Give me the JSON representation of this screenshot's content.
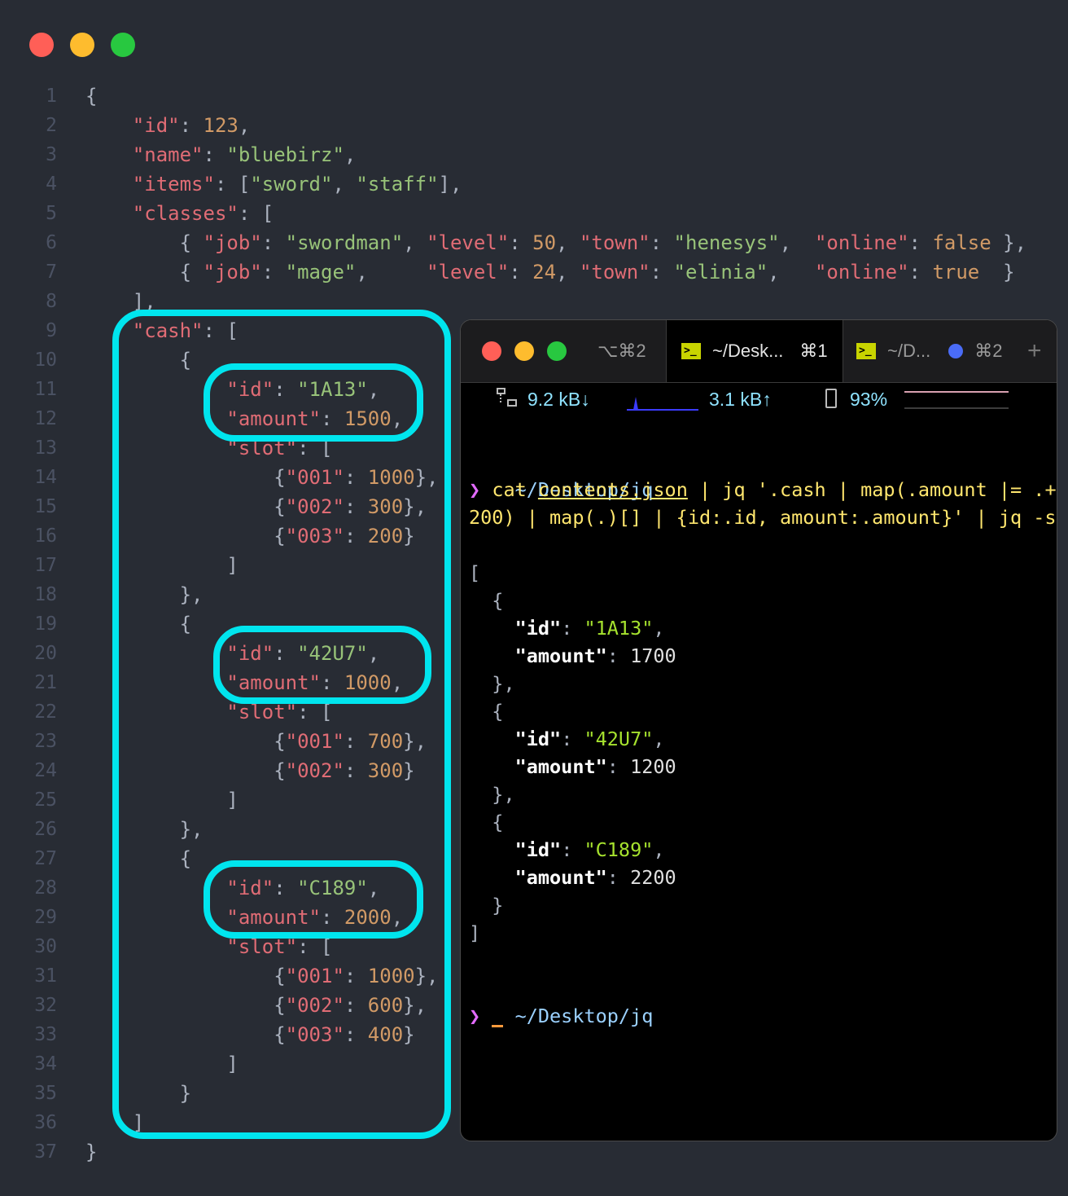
{
  "editor": {
    "line_numbers": [
      "1",
      "2",
      "3",
      "4",
      "5",
      "6",
      "7",
      "8",
      "9",
      "10",
      "11",
      "12",
      "13",
      "14",
      "15",
      "16",
      "17",
      "18",
      "19",
      "20",
      "21",
      "22",
      "23",
      "24",
      "25",
      "26",
      "27",
      "28",
      "29",
      "30",
      "31",
      "32",
      "33",
      "34",
      "35",
      "36",
      "37"
    ],
    "lines": [
      [
        [
          "p",
          "{"
        ]
      ],
      [
        [
          "p",
          "    "
        ],
        [
          "k",
          "\"id\""
        ],
        [
          "p",
          ": "
        ],
        [
          "n",
          "123"
        ],
        [
          "p",
          ","
        ]
      ],
      [
        [
          "p",
          "    "
        ],
        [
          "k",
          "\"name\""
        ],
        [
          "p",
          ": "
        ],
        [
          "s",
          "\"bluebirz\""
        ],
        [
          "p",
          ","
        ]
      ],
      [
        [
          "p",
          "    "
        ],
        [
          "k",
          "\"items\""
        ],
        [
          "p",
          ": ["
        ],
        [
          "s",
          "\"sword\""
        ],
        [
          "p",
          ", "
        ],
        [
          "s",
          "\"staff\""
        ],
        [
          "p",
          "],"
        ]
      ],
      [
        [
          "p",
          "    "
        ],
        [
          "k",
          "\"classes\""
        ],
        [
          "p",
          ": ["
        ]
      ],
      [
        [
          "p",
          "        { "
        ],
        [
          "k",
          "\"job\""
        ],
        [
          "p",
          ": "
        ],
        [
          "s",
          "\"swordman\""
        ],
        [
          "p",
          ", "
        ],
        [
          "k",
          "\"level\""
        ],
        [
          "p",
          ": "
        ],
        [
          "n",
          "50"
        ],
        [
          "p",
          ", "
        ],
        [
          "k",
          "\"town\""
        ],
        [
          "p",
          ": "
        ],
        [
          "s",
          "\"henesys\""
        ],
        [
          "p",
          ",  "
        ],
        [
          "k",
          "\"online\""
        ],
        [
          "p",
          ": "
        ],
        [
          "n",
          "false"
        ],
        [
          "p",
          " },"
        ]
      ],
      [
        [
          "p",
          "        { "
        ],
        [
          "k",
          "\"job\""
        ],
        [
          "p",
          ": "
        ],
        [
          "s",
          "\"mage\""
        ],
        [
          "p",
          ",     "
        ],
        [
          "k",
          "\"level\""
        ],
        [
          "p",
          ": "
        ],
        [
          "n",
          "24"
        ],
        [
          "p",
          ", "
        ],
        [
          "k",
          "\"town\""
        ],
        [
          "p",
          ": "
        ],
        [
          "s",
          "\"elinia\""
        ],
        [
          "p",
          ",   "
        ],
        [
          "k",
          "\"online\""
        ],
        [
          "p",
          ": "
        ],
        [
          "n",
          "true"
        ],
        [
          "p",
          "  }"
        ]
      ],
      [
        [
          "p",
          "    ],"
        ]
      ],
      [
        [
          "p",
          "    "
        ],
        [
          "k",
          "\"cash\""
        ],
        [
          "p",
          ": ["
        ]
      ],
      [
        [
          "p",
          "        {"
        ]
      ],
      [
        [
          "p",
          "            "
        ],
        [
          "k",
          "\"id\""
        ],
        [
          "p",
          ": "
        ],
        [
          "s",
          "\"1A13\""
        ],
        [
          "p",
          ","
        ]
      ],
      [
        [
          "p",
          "            "
        ],
        [
          "k",
          "\"amount\""
        ],
        [
          "p",
          ": "
        ],
        [
          "n",
          "1500"
        ],
        [
          "p",
          ","
        ]
      ],
      [
        [
          "p",
          "            "
        ],
        [
          "k",
          "\"slot\""
        ],
        [
          "p",
          ": ["
        ]
      ],
      [
        [
          "p",
          "                {"
        ],
        [
          "k",
          "\"001\""
        ],
        [
          "p",
          ": "
        ],
        [
          "n",
          "1000"
        ],
        [
          "p",
          "},"
        ]
      ],
      [
        [
          "p",
          "                {"
        ],
        [
          "k",
          "\"002\""
        ],
        [
          "p",
          ": "
        ],
        [
          "n",
          "300"
        ],
        [
          "p",
          "},"
        ]
      ],
      [
        [
          "p",
          "                {"
        ],
        [
          "k",
          "\"003\""
        ],
        [
          "p",
          ": "
        ],
        [
          "n",
          "200"
        ],
        [
          "p",
          "}"
        ]
      ],
      [
        [
          "p",
          "            ]"
        ]
      ],
      [
        [
          "p",
          "        },"
        ]
      ],
      [
        [
          "p",
          "        {"
        ]
      ],
      [
        [
          "p",
          "            "
        ],
        [
          "k",
          "\"id\""
        ],
        [
          "p",
          ": "
        ],
        [
          "s",
          "\"42U7\""
        ],
        [
          "p",
          ","
        ]
      ],
      [
        [
          "p",
          "            "
        ],
        [
          "k",
          "\"amount\""
        ],
        [
          "p",
          ": "
        ],
        [
          "n",
          "1000"
        ],
        [
          "p",
          ","
        ]
      ],
      [
        [
          "p",
          "            "
        ],
        [
          "k",
          "\"slot\""
        ],
        [
          "p",
          ": ["
        ]
      ],
      [
        [
          "p",
          "                {"
        ],
        [
          "k",
          "\"001\""
        ],
        [
          "p",
          ": "
        ],
        [
          "n",
          "700"
        ],
        [
          "p",
          "},"
        ]
      ],
      [
        [
          "p",
          "                {"
        ],
        [
          "k",
          "\"002\""
        ],
        [
          "p",
          ": "
        ],
        [
          "n",
          "300"
        ],
        [
          "p",
          "}"
        ]
      ],
      [
        [
          "p",
          "            ]"
        ]
      ],
      [
        [
          "p",
          "        },"
        ]
      ],
      [
        [
          "p",
          "        {"
        ]
      ],
      [
        [
          "p",
          "            "
        ],
        [
          "k",
          "\"id\""
        ],
        [
          "p",
          ": "
        ],
        [
          "s",
          "\"C189\""
        ],
        [
          "p",
          ","
        ]
      ],
      [
        [
          "p",
          "            "
        ],
        [
          "k",
          "\"amount\""
        ],
        [
          "p",
          ": "
        ],
        [
          "n",
          "2000"
        ],
        [
          "p",
          ","
        ]
      ],
      [
        [
          "p",
          "            "
        ],
        [
          "k",
          "\"slot\""
        ],
        [
          "p",
          ": ["
        ]
      ],
      [
        [
          "p",
          "                {"
        ],
        [
          "k",
          "\"001\""
        ],
        [
          "p",
          ": "
        ],
        [
          "n",
          "1000"
        ],
        [
          "p",
          "},"
        ]
      ],
      [
        [
          "p",
          "                {"
        ],
        [
          "k",
          "\"002\""
        ],
        [
          "p",
          ": "
        ],
        [
          "n",
          "600"
        ],
        [
          "p",
          "},"
        ]
      ],
      [
        [
          "p",
          "                {"
        ],
        [
          "k",
          "\"003\""
        ],
        [
          "p",
          ": "
        ],
        [
          "n",
          "400"
        ],
        [
          "p",
          "}"
        ]
      ],
      [
        [
          "p",
          "            ]"
        ]
      ],
      [
        [
          "p",
          "        }"
        ]
      ],
      [
        [
          "p",
          "    ]"
        ]
      ],
      [
        [
          "p",
          "}"
        ]
      ]
    ]
  },
  "terminal": {
    "tabs": {
      "first_shortcut": "⌥⌘2",
      "active_title": "~/Desk...",
      "active_shortcut": "⌘1",
      "second_title": "~/D...",
      "second_shortcut": "⌘2",
      "add_label": "+"
    },
    "status": {
      "download": "9.2 kB↓",
      "upload": "3.1 kB↑",
      "battery": "93%"
    },
    "cwd1": "~/Desktop/jq",
    "prompt_symbol": "❯",
    "command_line1": {
      "cat": "cat",
      "file": "contents.json",
      "rest": " | jq '.cash | map(.amount |= .+"
    },
    "command_line2": "200) | map(.)[] | {id:.id, amount:.amount}' | jq -s",
    "output": [
      [
        [
          "p",
          "["
        ]
      ],
      [
        [
          "p",
          "  {"
        ]
      ],
      [
        [
          "p",
          "    "
        ],
        [
          "jk",
          "\"id\""
        ],
        [
          "p",
          ": "
        ],
        [
          "js",
          "\"1A13\""
        ],
        [
          "p",
          ","
        ]
      ],
      [
        [
          "p",
          "    "
        ],
        [
          "jk",
          "\"amount\""
        ],
        [
          "p",
          ": "
        ],
        [
          "jn",
          "1700"
        ]
      ],
      [
        [
          "p",
          "  },"
        ]
      ],
      [
        [
          "p",
          "  {"
        ]
      ],
      [
        [
          "p",
          "    "
        ],
        [
          "jk",
          "\"id\""
        ],
        [
          "p",
          ": "
        ],
        [
          "js",
          "\"42U7\""
        ],
        [
          "p",
          ","
        ]
      ],
      [
        [
          "p",
          "    "
        ],
        [
          "jk",
          "\"amount\""
        ],
        [
          "p",
          ": "
        ],
        [
          "jn",
          "1200"
        ]
      ],
      [
        [
          "p",
          "  },"
        ]
      ],
      [
        [
          "p",
          "  {"
        ]
      ],
      [
        [
          "p",
          "    "
        ],
        [
          "jk",
          "\"id\""
        ],
        [
          "p",
          ": "
        ],
        [
          "js",
          "\"C189\""
        ],
        [
          "p",
          ","
        ]
      ],
      [
        [
          "p",
          "    "
        ],
        [
          "jk",
          "\"amount\""
        ],
        [
          "p",
          ": "
        ],
        [
          "jn",
          "2200"
        ]
      ],
      [
        [
          "p",
          "  }"
        ]
      ],
      [
        [
          "p",
          "]"
        ]
      ]
    ],
    "cwd2": "~/Desktop/jq"
  },
  "colors": {
    "highlight": "#00e5ee",
    "close": "#ff5f57",
    "minimize": "#febc2e",
    "maximize": "#28c840"
  }
}
